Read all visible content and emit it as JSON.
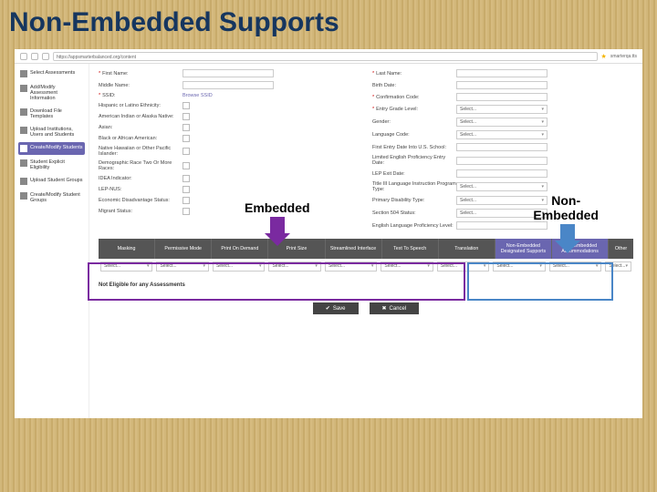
{
  "slide": {
    "title": "Non-Embedded Supports"
  },
  "chrome": {
    "url": "https://appsmarterbalanced.org/content",
    "signin": "smarterqa.tts"
  },
  "sidebar": {
    "items": [
      {
        "label": "Select Assessments"
      },
      {
        "label": "Add/Modify Assessment Information"
      },
      {
        "label": "Download File Templates"
      },
      {
        "label": "Upload Institutions, Users and Students"
      },
      {
        "label": "Create/Modify Students"
      },
      {
        "label": "Student Explicit Eligibility"
      },
      {
        "label": "Upload Student Groups"
      },
      {
        "label": "Create/Modify Student Groups"
      }
    ],
    "active_index": 4
  },
  "form": {
    "left": [
      {
        "label": "First Name:",
        "req": true,
        "type": "input"
      },
      {
        "label": "Middle Name:",
        "type": "input"
      },
      {
        "label": "SSID:",
        "req": true,
        "type": "link",
        "value": "Browse SSID"
      },
      {
        "label": "Hispanic or Latino Ethnicity:",
        "type": "check"
      },
      {
        "label": "American Indian or Alaska Native:",
        "type": "check"
      },
      {
        "label": "Asian:",
        "type": "check"
      },
      {
        "label": "Black or African American:",
        "type": "check"
      },
      {
        "label": "Native Hawaiian or Other Pacific Islander:",
        "type": "check"
      },
      {
        "label": "Demographic Race Two Or More Races:",
        "type": "check"
      },
      {
        "label": "IDEA Indicator:",
        "type": "check"
      },
      {
        "label": "LEP-NUS:",
        "type": "check"
      },
      {
        "label": "Economic Disadvantage Status:",
        "type": "check"
      },
      {
        "label": "Migrant Status:",
        "type": "check"
      }
    ],
    "right": [
      {
        "label": "Last Name:",
        "req": true,
        "type": "input"
      },
      {
        "label": "Birth Date:",
        "type": "input"
      },
      {
        "label": "Confirmation Code:",
        "req": true,
        "type": "input"
      },
      {
        "label": "Entry Grade Level:",
        "req": true,
        "type": "select",
        "value": "Select..."
      },
      {
        "label": "Gender:",
        "type": "select",
        "value": "Select..."
      },
      {
        "label": "Language Code:",
        "type": "select",
        "value": "Select..."
      },
      {
        "label": "First Entry Date Into U.S. School:",
        "type": "input"
      },
      {
        "label": "Limited English Proficiency Entry Date:",
        "type": "input"
      },
      {
        "label": "LEP Exit Date:",
        "type": "input"
      },
      {
        "label": "Title III Language Instruction Program Type:",
        "type": "select",
        "value": "Select..."
      },
      {
        "label": "Primary Disability Type:",
        "type": "select",
        "value": "Select..."
      },
      {
        "label": "Section 504 Status:",
        "type": "select",
        "value": "Select..."
      },
      {
        "label": "English Language Proficiency Level:",
        "type": "input"
      }
    ]
  },
  "callouts": {
    "embedded": "Embedded",
    "nonembedded_line1": "Non-",
    "nonembedded_line2": "Embedded"
  },
  "grid": {
    "headers": [
      "Masking",
      "Permissive Mode",
      "Print On Demand",
      "Print Size",
      "Streamlined Interface",
      "Text To Speech",
      "Translation"
    ],
    "ne_headers": [
      "Non-Embedded Designated Supports",
      "Non-Embedded Accommodations"
    ],
    "other": "Other",
    "select_placeholder": "Select..."
  },
  "notelig": "Not Eligible for any Assessments",
  "actions": {
    "save": "Save",
    "cancel": "Cancel"
  }
}
